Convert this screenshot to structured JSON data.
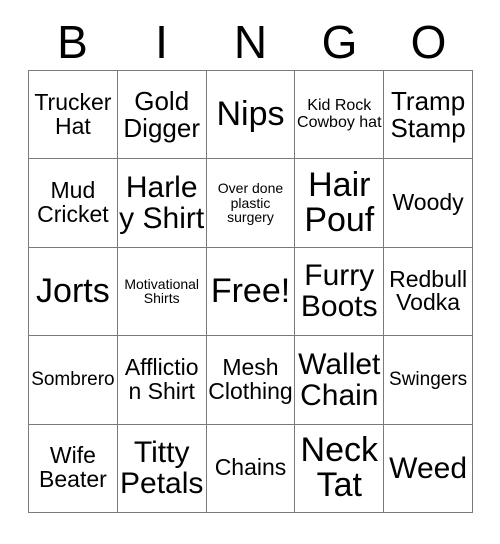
{
  "card": {
    "title": "Bingo Card",
    "header_letters": [
      "B",
      "I",
      "N",
      "G",
      "O"
    ],
    "free_space_label": "Free!",
    "border_color": "#7a7a7a",
    "background_color": "#ffffff",
    "text_color": "#000000",
    "rows": 5,
    "columns": 5,
    "cells": [
      [
        {
          "text": "Trucker Hat",
          "size": "md"
        },
        {
          "text": "Gold Digger",
          "size": "lg"
        },
        {
          "text": "Nips",
          "size": "xxl"
        },
        {
          "text": "Kid Rock Cowboy hat",
          "size": "xs"
        },
        {
          "text": "Tramp Stamp",
          "size": "lg"
        }
      ],
      [
        {
          "text": "Mud Cricket",
          "size": "md"
        },
        {
          "text": "Harley Shirt",
          "size": "xl"
        },
        {
          "text": "Over done plastic surgery",
          "size": "xxs"
        },
        {
          "text": "Hair Pouf",
          "size": "xxl"
        },
        {
          "text": "Woody",
          "size": "md"
        }
      ],
      [
        {
          "text": "Jorts",
          "size": "xxl"
        },
        {
          "text": "Motivational Shirts",
          "size": "xxs"
        },
        {
          "text": "Free!",
          "size": "xxl"
        },
        {
          "text": "Furry Boots",
          "size": "xl"
        },
        {
          "text": "Redbull Vodka",
          "size": "md"
        }
      ],
      [
        {
          "text": "Sombrero",
          "size": "sm"
        },
        {
          "text": "Affliction Shirt",
          "size": "md"
        },
        {
          "text": "Mesh Clothing",
          "size": "md"
        },
        {
          "text": "Wallet Chain",
          "size": "xl"
        },
        {
          "text": "Swingers",
          "size": "sm"
        }
      ],
      [
        {
          "text": "Wife Beater",
          "size": "md"
        },
        {
          "text": "Titty Petals",
          "size": "xl"
        },
        {
          "text": "Chains",
          "size": "md"
        },
        {
          "text": "Neck Tat",
          "size": "xxl"
        },
        {
          "text": "Weed",
          "size": "xl"
        }
      ]
    ]
  }
}
